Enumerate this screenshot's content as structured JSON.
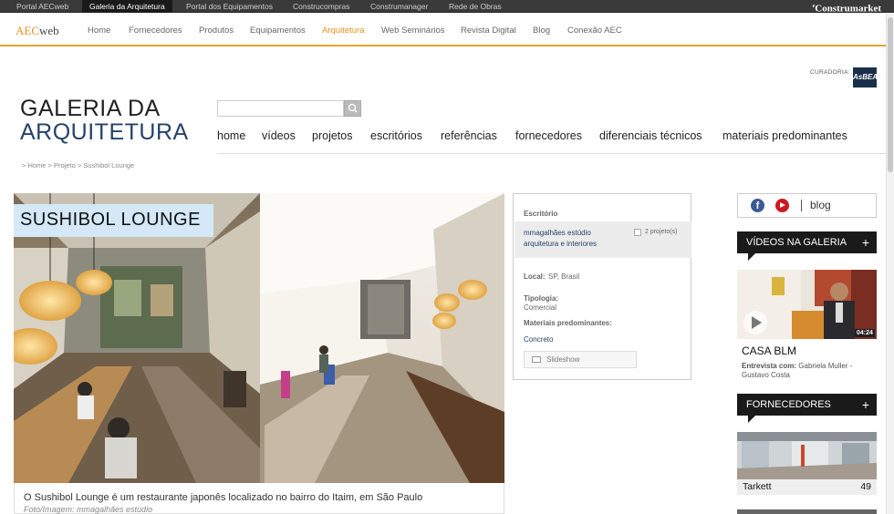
{
  "topbar": {
    "tabs": [
      "Portal AECweb",
      "Galeria da Arquitetura",
      "Portal dos Equipamentos",
      "Construcompras",
      "Construmanager",
      "Rede de Obras"
    ],
    "active_index": 1,
    "brand": "Construmarket",
    "brand_prefix": "e"
  },
  "nav": {
    "logo_aec": "AEC",
    "logo_web": "web",
    "items": [
      "Home",
      "Fornecedores",
      "Produtos",
      "Equipamentos",
      "Arquitetura",
      "Web Seminários",
      "Revista Digital",
      "Blog",
      "Conexão AEC"
    ],
    "active": "Arquitetura"
  },
  "curadoria": {
    "label": "CURADORIA:",
    "logo": "AsBEA"
  },
  "site_title": {
    "line1": "GALERIA DA",
    "line2": "ARQUITETURA"
  },
  "search": {
    "value": "",
    "placeholder": ""
  },
  "main_nav": [
    "home",
    "vídeos",
    "projetos",
    "escritórios",
    "referências",
    "fornecedores",
    "diferenciais técnicos",
    "materiais predominantes"
  ],
  "breadcrumb": "> Home > Projeto > Sushibol Lounge",
  "project": {
    "title": "SUSHIBOL LOUNGE",
    "caption": "O Sushibol Lounge é um restaurante japonês localizado no bairro do Itaim, em São Paulo",
    "credit": "Foto/Imagem: mmagalhães estúdio"
  },
  "info": {
    "office_label": "Escritório",
    "office_line1": "mmagalhães estúdio",
    "office_line2": "arquitetura e interiores",
    "projects_count": "2 projeto(s)",
    "local_label": "Local:",
    "local_value": "SP, Brasil",
    "tipologia_label": "Tipologia:",
    "tipologia_value": "Comercial",
    "materiais_label": "Materiais predominantes:",
    "materiais_value": "Concreto",
    "slideshow": "Slideshow"
  },
  "sidebar": {
    "social_fb": "f",
    "blog": "blog",
    "videos_header": "VÍDEOS NA GALERIA",
    "plus": "+",
    "video_time": "04:24",
    "video_title": "CASA BLM",
    "video_sub_bold": "Entrevista com:",
    "video_sub": "Gabriela Muller - Gustavo Costa",
    "fornecedores_header": "FORNECEDORES",
    "supplier_name": "Tarkett",
    "supplier_count": "49"
  }
}
